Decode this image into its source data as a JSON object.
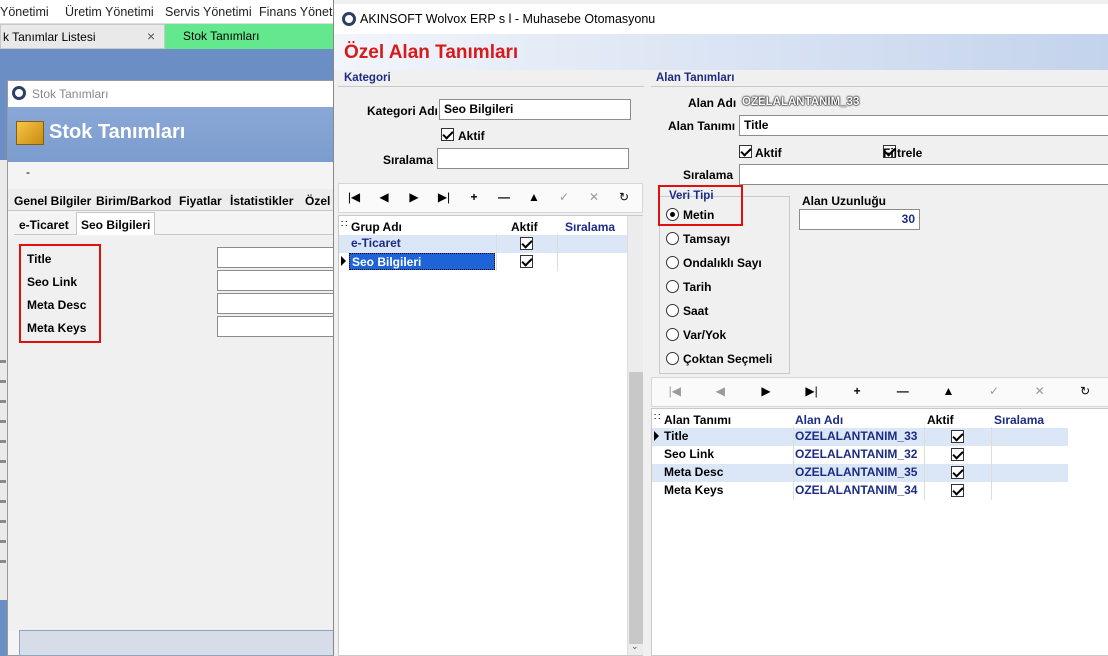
{
  "menubar": {
    "items": [
      "Üretim Yönetimi",
      "Servis Yönetimi",
      "Finans Yöneti"
    ],
    "partial": "Yönetimi"
  },
  "tabs": [
    {
      "label": "k Tanımlar Listesi",
      "close": "×"
    },
    {
      "label": "Stok Tanımları"
    }
  ],
  "stok_window": {
    "title": "Stok Tanımları",
    "header": "Stok Tanımları",
    "dash": "-",
    "tabs": [
      "Genel Bilgiler",
      "Birim/Barkod",
      "Fiyatlar",
      "İstatistikler",
      "Özel"
    ],
    "subtabs": [
      "e-Ticaret",
      "Seo Bilgileri"
    ],
    "fields": [
      "Title",
      "Seo Link",
      "Meta Desc",
      "Meta Keys"
    ]
  },
  "main_window": {
    "title": "AKINSOFT Wolvox ERP s           l - Muhasebe Otomasyonu",
    "header": "Özel Alan Tanımları",
    "kategori": {
      "section_title": "Kategori",
      "kategori_adi_label": "Kategori Adı",
      "kategori_adi_value": "Seo Bilgileri",
      "aktif_label": "Aktif",
      "aktif_checked": true,
      "siralama_label": "Sıralama",
      "siralama_value": "",
      "grid": {
        "columns": [
          "Grup Adı",
          "Aktif",
          "Sıralama"
        ],
        "rows": [
          {
            "grup_adi": "e-Ticaret",
            "aktif": true,
            "siralama": ""
          },
          {
            "grup_adi": "Seo Bilgileri",
            "aktif": true,
            "siralama": "",
            "selected": true
          }
        ]
      }
    },
    "alan": {
      "section_title": "Alan Tanımları",
      "alan_adi_label": "Alan Adı",
      "alan_adi_value": "OZELALANTANIM_33",
      "alan_tanimi_label": "Alan Tanımı",
      "alan_tanimi_value": "Title",
      "aktif_label": "Aktif",
      "filtrele_label": "Filtrele",
      "siralama_label": "Sıralama",
      "veri_tipi_label": "Veri Tipi",
      "veri_tipleri": [
        "Metin",
        "Tamsayı",
        "Ondalıklı Sayı",
        "Tarih",
        "Saat",
        "Var/Yok",
        "Çoktan Seçmeli"
      ],
      "selected_veri_tipi": "Metin",
      "alan_uzunlugu_label": "Alan Uzunluğu",
      "alan_uzunlugu_value": "30",
      "grid": {
        "columns": [
          "Alan Tanımı",
          "Alan Adı",
          "Aktif",
          "Sıralama"
        ],
        "rows": [
          {
            "alan_tanimi": "Title",
            "alan_adi": "OZELALANTANIM_33",
            "aktif": true,
            "siralama": ""
          },
          {
            "alan_tanimi": "Seo Link",
            "alan_adi": "OZELALANTANIM_32",
            "aktif": true,
            "siralama": ""
          },
          {
            "alan_tanimi": "Meta Desc",
            "alan_adi": "OZELALANTANIM_35",
            "aktif": true,
            "siralama": ""
          },
          {
            "alan_tanimi": "Meta Keys",
            "alan_adi": "OZELALANTANIM_34",
            "aktif": true,
            "siralama": ""
          }
        ]
      }
    },
    "toolbar_icons": [
      "first-icon",
      "prev-icon",
      "next-icon",
      "last-icon",
      "add-icon",
      "delete-icon",
      "up-icon",
      "confirm-icon",
      "cancel-icon",
      "refresh-icon"
    ],
    "toolbar_glyphs": [
      "|◀",
      "◀",
      "▶",
      "▶|",
      "+",
      "—",
      "▲",
      "✓",
      "✕",
      "↻"
    ]
  },
  "colors": {
    "accent_red": "#e01010",
    "header_title": "#d81a1a",
    "navy": "#1c2c86",
    "selection": "#1f63d8",
    "row_alt": "#dbe7f7",
    "tab_green": "#64e88e"
  }
}
